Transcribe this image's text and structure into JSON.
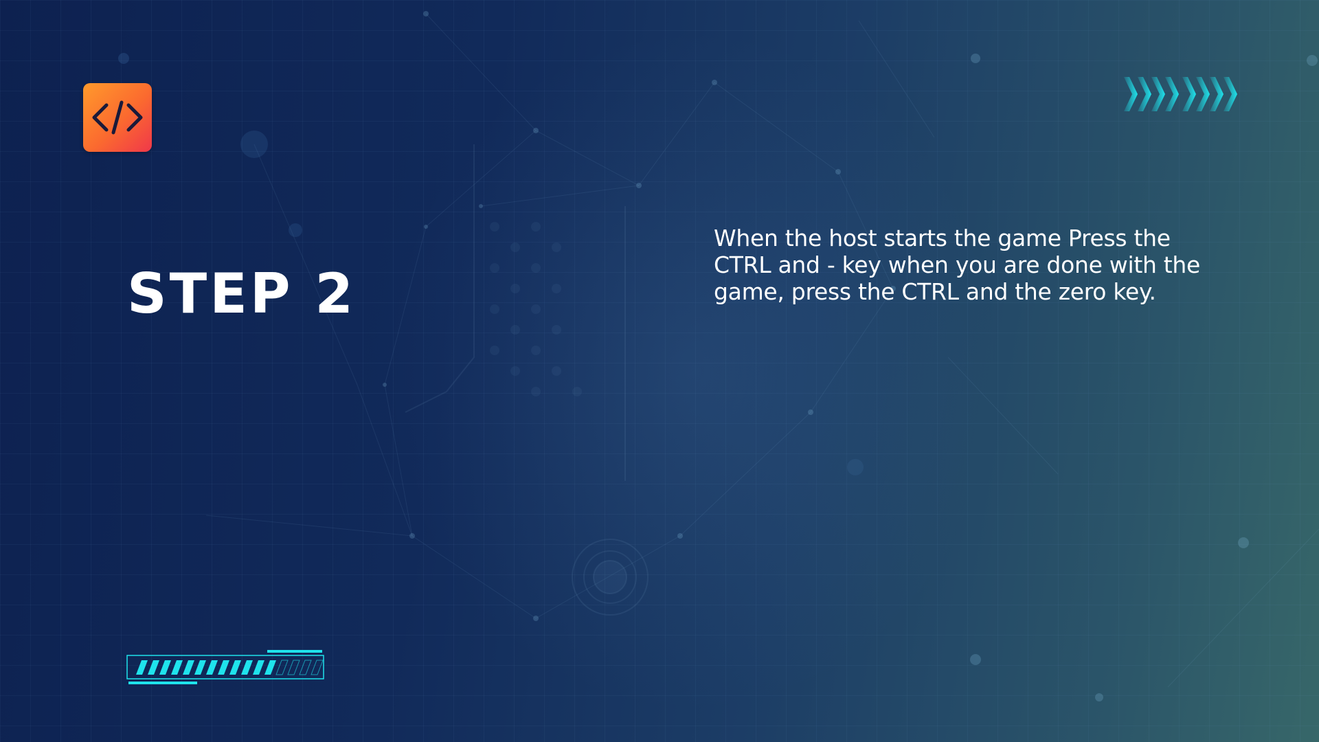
{
  "slide": {
    "title": "STEP 2",
    "body": "When the host starts the game Press the CTRL and - key when you are done with the game, press the CTRL and the zero key."
  },
  "logo": {
    "icon": "code-brackets-icon"
  },
  "decor": {
    "chevron_icon": "chevron-arrows-icon",
    "progress_icon": "progress-bar-icon",
    "progress": {
      "filled": 12,
      "total": 16
    }
  },
  "colors": {
    "accent": "#1fe3ec",
    "logo_start": "#ff9a2c",
    "logo_end": "#f0384a",
    "text": "#ffffff"
  }
}
